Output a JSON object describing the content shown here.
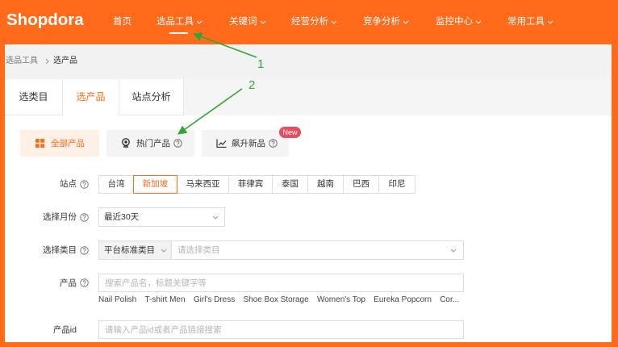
{
  "colors": {
    "brand": "#ff6a1b",
    "annotation": "#33a532",
    "new_badge": "#e94b5f"
  },
  "brand": {
    "logo_text": "Shopdora"
  },
  "nav": {
    "items": [
      {
        "label": "首页",
        "active": false
      },
      {
        "label": "选品工具",
        "active": true
      },
      {
        "label": "关键词",
        "active": false
      },
      {
        "label": "经营分析",
        "active": false
      },
      {
        "label": "竞争分析",
        "active": false
      },
      {
        "label": "监控中心",
        "active": false
      },
      {
        "label": "常用工具",
        "active": false
      }
    ]
  },
  "breadcrumb": {
    "parent": "选品工具",
    "current": "选产品"
  },
  "tabs": [
    {
      "label": "选类目",
      "active": false
    },
    {
      "label": "选产品",
      "active": true
    },
    {
      "label": "站点分析",
      "active": false
    }
  ],
  "product_types": [
    {
      "label": "全部产品",
      "icon": "grid-icon",
      "active": true
    },
    {
      "label": "热门产品",
      "icon": "medal-icon",
      "active": false
    },
    {
      "label": "飙升新品",
      "icon": "trend-chart-icon",
      "active": false,
      "badge": "New"
    }
  ],
  "form": {
    "site": {
      "label": "站点",
      "options": [
        {
          "label": "台湾",
          "selected": false
        },
        {
          "label": "新加坡",
          "selected": true
        },
        {
          "label": "马来西亚",
          "selected": false
        },
        {
          "label": "菲律宾",
          "selected": false
        },
        {
          "label": "泰国",
          "selected": false
        },
        {
          "label": "越南",
          "selected": false
        },
        {
          "label": "巴西",
          "selected": false
        },
        {
          "label": "印尼",
          "selected": false
        }
      ]
    },
    "month": {
      "label": "选择月份",
      "value": "最近30天"
    },
    "category": {
      "label": "选择类目",
      "type_value": "平台标准类目",
      "placeholder": "请选择类目"
    },
    "product": {
      "label": "产品",
      "placeholder": "搜索产品名，标题关键字等",
      "suggestions": [
        "Nail Polish",
        "T-shirt Men",
        "Girl's Dress",
        "Shoe Box Storage",
        "Women's Top",
        "Eureka Popcorn",
        "Cor..."
      ]
    },
    "product_id": {
      "label": "产品id",
      "placeholder": "请输入产品id或者产品链接搜索"
    }
  },
  "annotations": [
    {
      "label": "1"
    },
    {
      "label": "2"
    }
  ]
}
